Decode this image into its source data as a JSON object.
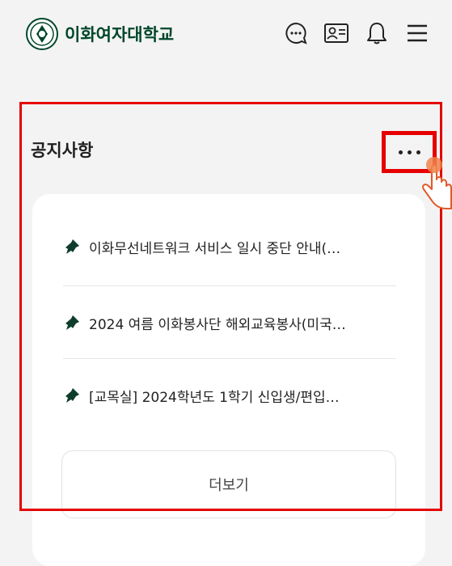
{
  "header": {
    "logo_text": "이화여자대학교",
    "icons": [
      "chat-icon",
      "id-card-icon",
      "bell-icon",
      "menu-icon"
    ]
  },
  "notice_section": {
    "title": "공지사항",
    "more_dots_label": "···",
    "items": [
      {
        "text": "이화무선네트워크 서비스 일시 중단 안내(…"
      },
      {
        "text": "2024 여름 이화봉사단 해외교육봉사(미국…"
      },
      {
        "text": "[교목실] 2024학년도 1학기 신입생/편입…"
      }
    ],
    "more_button_label": "더보기"
  },
  "colors": {
    "brand_green": "#00462a",
    "highlight_red": "#e60000",
    "background": "#f3f3f3"
  }
}
